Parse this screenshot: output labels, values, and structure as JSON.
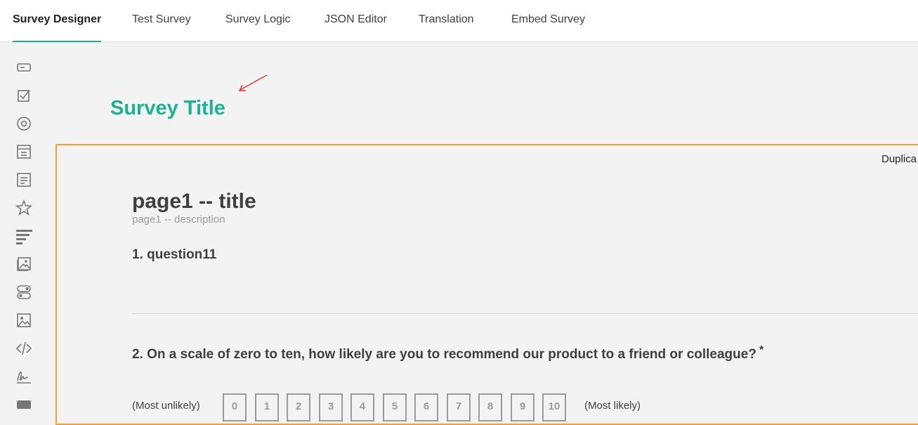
{
  "tabs": [
    {
      "label": "Survey Designer",
      "active": true
    },
    {
      "label": "Test Survey"
    },
    {
      "label": "Survey Logic"
    },
    {
      "label": "JSON Editor"
    },
    {
      "label": "Translation"
    },
    {
      "label": "Embed Survey"
    }
  ],
  "toolbox": [
    "text-input-icon",
    "checkbox-icon",
    "radio-icon",
    "dropdown-icon",
    "comment-icon",
    "rating-icon",
    "ranking-icon",
    "image-picker-icon",
    "boolean-icon",
    "image-icon",
    "html-icon",
    "signature-icon",
    "expression-icon"
  ],
  "survey": {
    "title": "Survey Title",
    "accent_color": "#1ab394",
    "selection_color": "#f5a031"
  },
  "page": {
    "duplicate_label": "Duplica",
    "title": "page1 -- title",
    "description": "page1 -- description"
  },
  "questions": [
    {
      "title": "1. question11"
    },
    {
      "title": "2. On a scale of zero to ten, how likely are you to recommend our product to a friend or colleague?",
      "required_mark": "*",
      "min_label": "(Most unlikely)",
      "max_label": "(Most likely)",
      "rates": [
        "0",
        "1",
        "2",
        "3",
        "4",
        "5",
        "6",
        "7",
        "8",
        "9",
        "10"
      ]
    }
  ]
}
